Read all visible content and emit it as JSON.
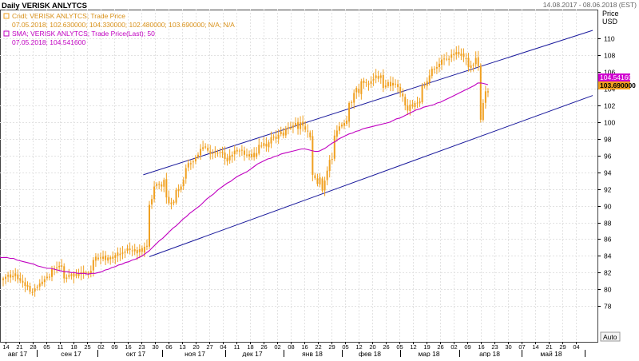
{
  "header": {
    "title": "Daily VERISK ANLYTCS",
    "date_range": "14.08.2017 - 08.06.2018 (EST)"
  },
  "legend": {
    "candle_line": "Cndl; VERISK ANLYTCS; Trade Price",
    "candle_values": "07.05.2018; 102.630000; 104.330000; 102.480000; 103.690000; N/A; N/A",
    "sma_line": "SMA; VERISK ANLYTCS; Trade Price(Last); 50",
    "sma_values": "07.05.2018; 104.541600"
  },
  "price_axis": {
    "title_1": "Price",
    "title_2": "USD"
  },
  "auto_button": "Auto",
  "last_labels": {
    "sma": "104.541600",
    "close": "103.690000"
  },
  "colors": {
    "candle": "#f0a020",
    "sma": "#c000c0",
    "channel": "#1a1a9c",
    "sma_label_bg": "#d000d0",
    "close_label_bg": "#f0a020",
    "grid": "#e2e2e2",
    "axis": "#000000"
  },
  "chart_data": {
    "type": "line",
    "title": "Daily VERISK ANLYTCS",
    "ylim": [
      76,
      111
    ],
    "y_ticks": [
      78,
      80,
      82,
      84,
      86,
      88,
      90,
      92,
      94,
      96,
      98,
      100,
      102,
      104,
      106,
      108,
      110
    ],
    "x_day_ticks": [
      "14",
      "21",
      "28",
      "05",
      "11",
      "18",
      "25",
      "02",
      "09",
      "16",
      "23",
      "30",
      "06",
      "13",
      "20",
      "27",
      "04",
      "11",
      "18",
      "26",
      "02",
      "08",
      "16",
      "22",
      "29",
      "05",
      "12",
      "20",
      "26",
      "05",
      "12",
      "19",
      "26",
      "02",
      "09",
      "16",
      "23",
      "30",
      "07",
      "14",
      "21",
      "29",
      "04"
    ],
    "x_month_labels": [
      "авг 17",
      "сен 17",
      "окт 17",
      "ноя 17",
      "дек 17",
      "янв 18",
      "фев 18",
      "мар 18",
      "апр 18",
      "май 18"
    ],
    "series": [
      {
        "name": "Cndl; VERISK ANLYTCS; Trade Price",
        "kind": "candlestick",
        "close": [
          81.3,
          81.5,
          81.7,
          81.4,
          81.6,
          81.9,
          81.2,
          81.0,
          80.8,
          80.4,
          80.3,
          79.7,
          79.6,
          80.1,
          80.3,
          80.7,
          80.9,
          81.2,
          81.5,
          81.5,
          82.4,
          82.5,
          82.6,
          82.8,
          82.7,
          81.3,
          81.4,
          81.7,
          81.6,
          81.9,
          81.6,
          81.9,
          81.8,
          82.1,
          82.0,
          82.0,
          82.2,
          83.5,
          83.9,
          83.6,
          83.8,
          83.9,
          83.5,
          83.8,
          83.6,
          83.9,
          84.1,
          84.4,
          84.1,
          84.4,
          84.5,
          84.9,
          84.7,
          84.6,
          84.8,
          84.3,
          84.8,
          84.5,
          85.1,
          85.2,
          90.1,
          90.8,
          92.3,
          92.6,
          92.6,
          92.3,
          93.1,
          91.0,
          90.3,
          90.2,
          90.5,
          91.9,
          92.0,
          92.3,
          93.1,
          94.5,
          95.1,
          95.1,
          95.3,
          95.8,
          96.1,
          96.8,
          97.0,
          97.1,
          96.6,
          96.2,
          96.3,
          96.3,
          96.3,
          96.4,
          96.3,
          95.6,
          95.3,
          96.0,
          96.1,
          96.6,
          96.5,
          96.6,
          96.6,
          96.1,
          96.1,
          95.9,
          96.2,
          95.8,
          96.3,
          97.3,
          97.1,
          97.5,
          97.1,
          97.6,
          98.2,
          98.2,
          98.0,
          98.5,
          98.9,
          98.4,
          99.2,
          99.4,
          99.3,
          99.6,
          99.9,
          99.2,
          100.0,
          99.6,
          99.1,
          98.9,
          98.2,
          93.7,
          93.3,
          92.6,
          93.4,
          91.8,
          93.0,
          94.2,
          95.5,
          95.6,
          98.4,
          99.0,
          99.5,
          99.7,
          99.9,
          100.2,
          102.3,
          102.4,
          103.5,
          104.1,
          103.5,
          104.9,
          104.7,
          104.7,
          104.5,
          104.9,
          105.2,
          105.6,
          105.2,
          105.6,
          104.1,
          104.4,
          104.8,
          104.3,
          104.7,
          104.6,
          104.2,
          103.5,
          103.1,
          102.0,
          101.4,
          102.1,
          101.9,
          102.3,
          102.3,
          102.5,
          104.4,
          104.3,
          104.9,
          105.6,
          106.4,
          106.4,
          106.6,
          107.0,
          107.5,
          107.6,
          107.6,
          107.6,
          108.1,
          108.2,
          108.4,
          108.1,
          108.2,
          107.8,
          107.6,
          106.6,
          106.8,
          106.9,
          107.7,
          106.7,
          100.3,
          102.3,
          103.7,
          103.7
        ],
        "last_close": 103.69
      },
      {
        "name": "SMA; VERISK ANLYTCS; Trade Price(Last); 50",
        "kind": "line",
        "values": [
          83.8,
          83.8,
          83.8,
          83.7,
          83.7,
          83.5,
          83.4,
          83.3,
          83.2,
          83.1,
          83.0,
          82.8,
          82.7,
          82.6,
          82.5,
          82.5,
          82.4,
          82.3,
          82.2,
          82.1,
          82.1,
          82.0,
          82.0,
          81.9,
          81.9,
          81.9,
          81.8,
          81.9,
          81.9,
          82.0,
          82.1,
          82.3,
          82.4,
          82.6,
          82.7,
          82.9,
          83.0,
          83.2,
          83.3,
          83.5,
          83.6,
          83.8,
          84.0,
          84.3,
          84.6,
          85.0,
          85.4,
          85.8,
          86.1,
          86.5,
          86.9,
          87.3,
          87.6,
          88.0,
          88.4,
          88.7,
          89.1,
          89.4,
          89.7,
          90.0,
          90.4,
          90.8,
          91.1,
          91.4,
          91.8,
          92.1,
          92.4,
          92.7,
          92.9,
          93.2,
          93.5,
          93.7,
          93.9,
          94.1,
          94.4,
          94.7,
          95.0,
          95.2,
          95.4,
          95.6,
          95.7,
          95.9,
          96.0,
          96.2,
          96.3,
          96.4,
          96.5,
          96.6,
          96.7,
          96.8,
          96.8,
          96.7,
          96.6,
          96.5,
          96.5,
          96.7,
          96.9,
          97.2,
          97.5,
          97.7,
          98.0,
          98.2,
          98.4,
          98.6,
          98.7,
          98.9,
          99.0,
          99.2,
          99.3,
          99.4,
          99.5,
          99.6,
          99.7,
          99.8,
          99.9,
          100.0,
          100.2,
          100.4,
          100.5,
          100.7,
          100.9,
          101.1,
          101.3,
          101.5,
          101.6,
          101.8,
          101.9,
          102.0,
          102.1,
          102.3,
          102.4,
          102.6,
          102.8,
          103.0,
          103.2,
          103.4,
          103.6,
          103.8,
          104.0,
          104.2,
          104.4,
          104.7,
          104.7,
          104.6,
          104.5
        ],
        "last_value": 104.5416
      },
      {
        "name": "channel_upper",
        "kind": "trendline",
        "points": [
          [
            "23.10.2017",
            93.7
          ],
          [
            "07.06.2018",
            111.0
          ]
        ]
      },
      {
        "name": "channel_lower",
        "kind": "trendline",
        "points": [
          [
            "30.10.2017",
            83.9
          ],
          [
            "07.06.2018",
            103.2
          ]
        ]
      }
    ]
  }
}
